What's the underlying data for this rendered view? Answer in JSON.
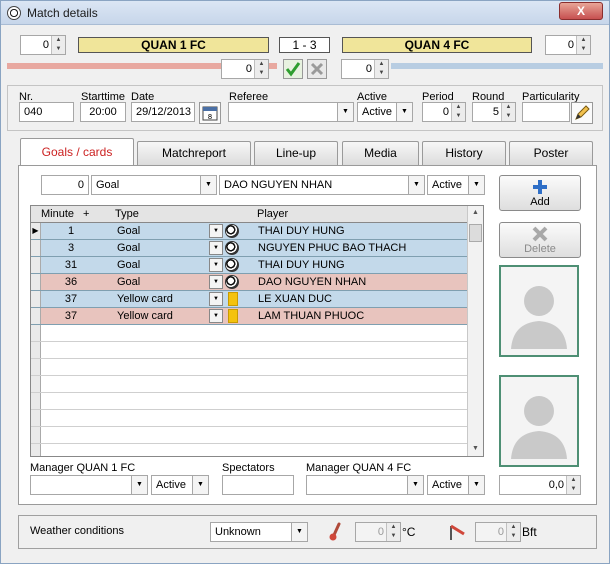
{
  "window": {
    "title": "Match details",
    "close_label": "X"
  },
  "header": {
    "home_team": "QUAN 1 FC",
    "away_team": "QUAN 4 FC",
    "result": "1 - 3",
    "home_spin_value": "0",
    "away_spin_value": "0",
    "home_half_score": "0",
    "away_half_score": "0"
  },
  "fields": {
    "nr_label": "Nr.",
    "nr_value": "040",
    "starttime_label": "Starttime",
    "starttime_value": "20:00",
    "date_label": "Date",
    "date_value": "29/12/2013",
    "referee_label": "Referee",
    "referee_value": "",
    "active_label": "Active",
    "active_value": "Active",
    "period_label": "Period",
    "period_value": "0",
    "round_label": "Round",
    "round_value": "5",
    "particularity_label": "Particularity",
    "particularity_value": ""
  },
  "tabs": [
    {
      "label": "Goals / cards",
      "active": true
    },
    {
      "label": "Matchreport"
    },
    {
      "label": "Line-up"
    },
    {
      "label": "Media"
    },
    {
      "label": "History"
    },
    {
      "label": "Poster"
    }
  ],
  "entry": {
    "minute": "0",
    "type": "Goal",
    "player": "DAO NGUYEN NHAN",
    "status": "Active"
  },
  "grid": {
    "columns": {
      "minute": "Minute",
      "plus": "+",
      "type": "Type",
      "player": "Player"
    },
    "rows": [
      {
        "minute": "1",
        "type": "Goal",
        "player": "THAI DUY HUNG",
        "side": "home",
        "icon": "ball"
      },
      {
        "minute": "3",
        "type": "Goal",
        "player": "NGUYEN PHUC BAO THACH",
        "side": "home",
        "icon": "ball"
      },
      {
        "minute": "31",
        "type": "Goal",
        "player": "THAI DUY HUNG",
        "side": "home",
        "icon": "ball"
      },
      {
        "minute": "36",
        "type": "Goal",
        "player": "DAO NGUYEN NHAN",
        "side": "away",
        "icon": "ball"
      },
      {
        "minute": "37",
        "type": "Yellow card",
        "player": "LE XUAN DUC",
        "side": "home",
        "icon": "yellow-card"
      },
      {
        "minute": "37",
        "type": "Yellow card",
        "player": "LAM THUAN PHUOC",
        "side": "away",
        "icon": "yellow-card"
      }
    ]
  },
  "buttons": {
    "add": "Add",
    "delete": "Delete"
  },
  "footer": {
    "manager_home_label": "Manager QUAN 1 FC",
    "manager_home_value": "",
    "manager_home_status": "Active",
    "spectators_label": "Spectators",
    "spectators_value": "",
    "manager_away_label": "Manager QUAN 4 FC",
    "manager_away_value": "",
    "manager_away_status": "Active",
    "rating_value": "0,0"
  },
  "weather": {
    "label": "Weather conditions",
    "condition": "Unknown",
    "temperature": "0",
    "temp_unit": "°C",
    "wind": "0",
    "wind_unit": "Bft"
  },
  "colors": {
    "team_bar": "#f0e59a",
    "home_row": "#c3d9ea",
    "away_row": "#e8c4be",
    "active_tab_text": "#cc2222",
    "accept_green": "#2f9e2f"
  }
}
